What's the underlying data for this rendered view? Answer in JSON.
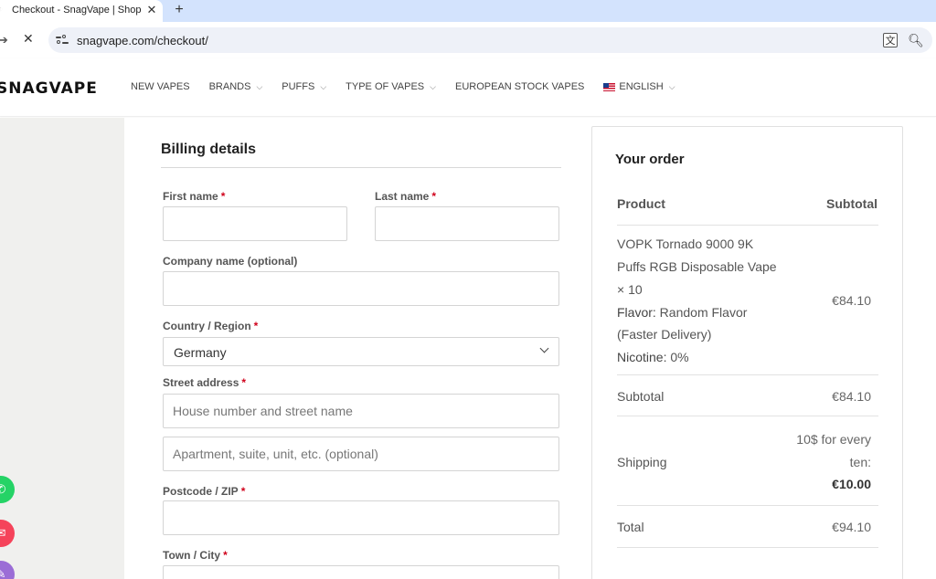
{
  "browser": {
    "tab_title": "Checkout - SnagVape | Shop",
    "url": "snagvape.com/checkout/"
  },
  "header": {
    "logo": "SNAGVAPE",
    "nav": [
      {
        "label": "NEW VAPES",
        "has_dropdown": false
      },
      {
        "label": "BRANDS",
        "has_dropdown": true
      },
      {
        "label": "PUFFS",
        "has_dropdown": true
      },
      {
        "label": "TYPE OF VAPES",
        "has_dropdown": true
      },
      {
        "label": "EUROPEAN STOCK VAPES",
        "has_dropdown": false
      },
      {
        "label": "ENGLISH",
        "has_dropdown": true
      }
    ]
  },
  "billing": {
    "title": "Billing details",
    "first_name_label": "First name",
    "last_name_label": "Last name",
    "company_label": "Company name (optional)",
    "country_label": "Country / Region",
    "country_value": "Germany",
    "street_label": "Street address",
    "street_placeholder": "House number and street name",
    "apartment_placeholder": "Apartment, suite, unit, etc. (optional)",
    "postcode_label": "Postcode / ZIP",
    "town_label": "Town / City",
    "required_marker": "*"
  },
  "order": {
    "title": "Your order",
    "col_product": "Product",
    "col_subtotal": "Subtotal",
    "item": {
      "name_line1": "VOPK Tornado 9000 9K",
      "name_line2": "Puffs RGB Disposable Vape",
      "qty": "× 10",
      "flavor_key": "Flavor:",
      "flavor_value": " Random Flavor",
      "flavor_value2": "(Faster Delivery)",
      "nicotine_key": "Nicotine:",
      "nicotine_value": " 0%",
      "price": "€84.10"
    },
    "subtotal_label": "Subtotal",
    "subtotal_value": "€84.10",
    "shipping_label": "Shipping",
    "shipping_line1": "10$ for every",
    "shipping_line2": "ten:",
    "shipping_value": "€10.00",
    "total_label": "Total",
    "total_value": "€94.10"
  },
  "colors": {
    "required": "#d0021b",
    "whatsapp": "#25d366",
    "mail": "#f5435a",
    "chat": "#9b6dd6"
  }
}
